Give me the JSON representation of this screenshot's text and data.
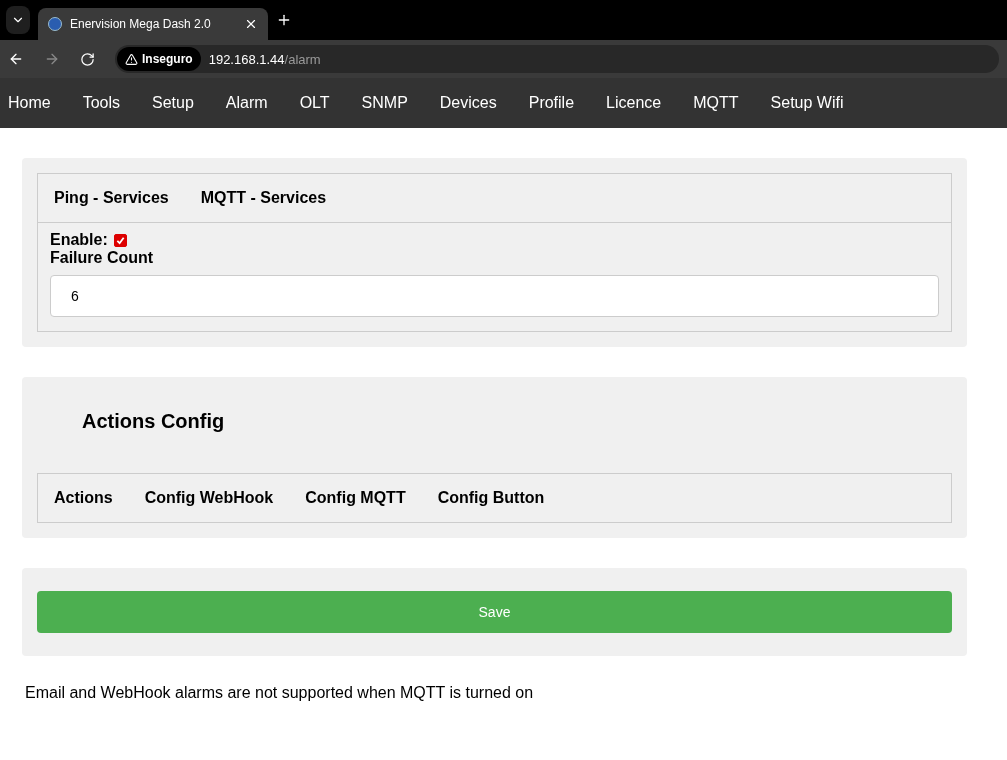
{
  "browser": {
    "tab_title": "Enervision Mega Dash 2.0",
    "security_label": "Inseguro",
    "url_host": "192.168.1.44",
    "url_path": "/alarm"
  },
  "nav": [
    "Home",
    "Tools",
    "Setup",
    "Alarm",
    "OLT",
    "SNMP",
    "Devices",
    "Profile",
    "Licence",
    "MQTT",
    "Setup Wifi"
  ],
  "services": {
    "tabs": [
      "Ping - Services",
      "MQTT - Services"
    ],
    "enable_label": "Enable:",
    "enable_checked": true,
    "failure_label": "Failure Count",
    "failure_value": "6"
  },
  "actions": {
    "title": "Actions Config",
    "tabs": [
      "Actions",
      "Config WebHook",
      "Config MQTT",
      "Config Button"
    ]
  },
  "save_button": "Save",
  "note": "Email and WebHook alarms are not supported when MQTT is turned on"
}
